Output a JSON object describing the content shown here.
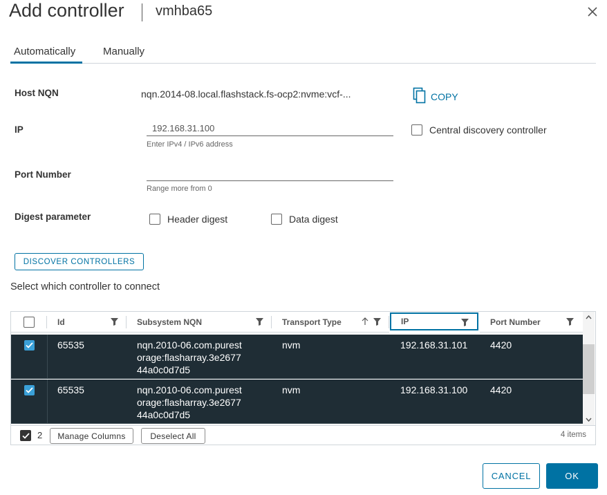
{
  "dialog": {
    "title": "Add controller",
    "subtitle": "vmhba65"
  },
  "tabs": [
    {
      "label": "Automatically",
      "active": true
    },
    {
      "label": "Manually",
      "active": false
    }
  ],
  "form": {
    "host_nqn_label": "Host NQN",
    "host_nqn_value": "nqn.2014-08.local.flashstack.fs-ocp2:nvme:vcf-...",
    "copy_label": "COPY",
    "ip_label": "IP",
    "ip_value": "192.168.31.100",
    "ip_helper": "Enter IPv4 / IPv6 address",
    "central_discovery_label": "Central discovery controller",
    "port_label": "Port Number",
    "port_value": "",
    "port_helper": "Range more from 0",
    "digest_label": "Digest parameter",
    "header_digest_label": "Header digest",
    "data_digest_label": "Data digest"
  },
  "discover_button": "DISCOVER CONTROLLERS",
  "select_text": "Select which controller to connect",
  "grid": {
    "columns": [
      "Id",
      "Subsystem NQN",
      "Transport Type",
      "IP",
      "Port Number"
    ],
    "rows": [
      {
        "id": "65535",
        "nqn_lines": [
          "nqn.2010-06.com.purest",
          "orage:flasharray.3e2677",
          "44a0c0d7d5"
        ],
        "transport": "nvm",
        "ip": "192.168.31.101",
        "port": "4420",
        "selected": true
      },
      {
        "id": "65535",
        "nqn_lines": [
          "nqn.2010-06.com.purest",
          "orage:flasharray.3e2677",
          "44a0c0d7d5"
        ],
        "transport": "nvm",
        "ip": "192.168.31.100",
        "port": "4420",
        "selected": true
      }
    ],
    "selected_count": "2",
    "manage_columns": "Manage Columns",
    "deselect_all": "Deselect All",
    "items_count": "4 items"
  },
  "actions": {
    "cancel": "CANCEL",
    "ok": "OK"
  },
  "colors": {
    "accent": "#0072a3",
    "row_selected_bg": "#1f2d35",
    "checkbox_checked": "#3aa0d8"
  }
}
